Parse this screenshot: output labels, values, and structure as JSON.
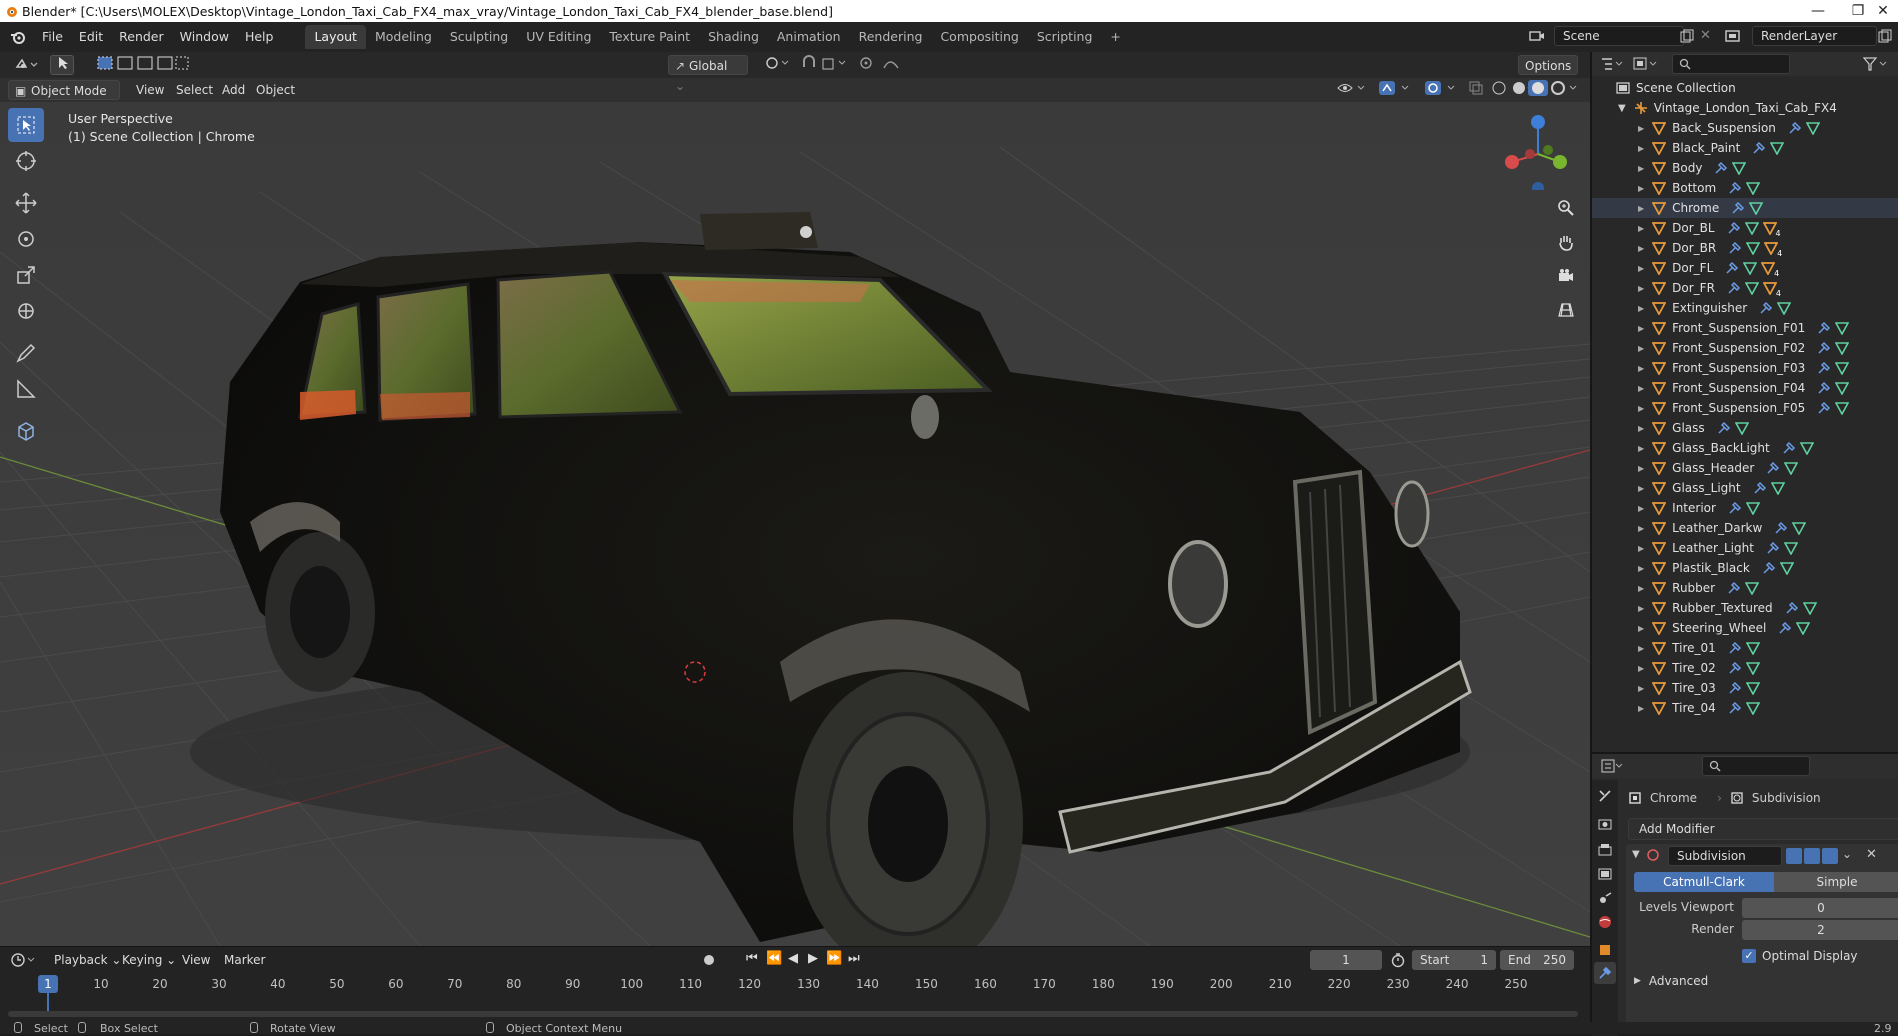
{
  "title_bar": {
    "text": "Blender* [C:\\Users\\MOLEX\\Desktop\\Vintage_London_Taxi_Cab_FX4_max_vray/Vintage_London_Taxi_Cab_FX4_blender_base.blend]",
    "minimize": "—",
    "maximize": "❐",
    "close": "✕"
  },
  "menu": [
    "File",
    "Edit",
    "Render",
    "Window",
    "Help"
  ],
  "workspaces": [
    "Layout",
    "Modeling",
    "Sculpting",
    "UV Editing",
    "Texture Paint",
    "Shading",
    "Animation",
    "Rendering",
    "Compositing",
    "Scripting",
    "+"
  ],
  "scene": {
    "name": "Scene",
    "render_layer": "RenderLayer"
  },
  "viewport_header": {
    "transform_orientation": "Global",
    "options_label": "Options ⌄",
    "mode": "Object Mode",
    "menus": [
      "View",
      "Select",
      "Add",
      "Object"
    ]
  },
  "viewport": {
    "perspective": "User Perspective",
    "collection_info": "(1) Scene Collection | Chrome",
    "accent": "#4772b3"
  },
  "outliner": {
    "root": "Scene Collection",
    "collection": "Vintage_London_Taxi_Cab_FX4",
    "items": [
      {
        "name": "Back_Suspension",
        "extra": false
      },
      {
        "name": "Black_Paint",
        "extra": false
      },
      {
        "name": "Body",
        "extra": false
      },
      {
        "name": "Bottom",
        "extra": false
      },
      {
        "name": "Chrome",
        "extra": false,
        "active": true
      },
      {
        "name": "Dor_BL",
        "extra": true,
        "extra_count": "4"
      },
      {
        "name": "Dor_BR",
        "extra": true,
        "extra_count": "4"
      },
      {
        "name": "Dor_FL",
        "extra": true,
        "extra_count": "4"
      },
      {
        "name": "Dor_FR",
        "extra": true,
        "extra_count": "4"
      },
      {
        "name": "Extinguisher",
        "extra": false
      },
      {
        "name": "Front_Suspension_F01",
        "extra": false
      },
      {
        "name": "Front_Suspension_F02",
        "extra": false
      },
      {
        "name": "Front_Suspension_F03",
        "extra": false
      },
      {
        "name": "Front_Suspension_F04",
        "extra": false
      },
      {
        "name": "Front_Suspension_F05",
        "extra": false
      },
      {
        "name": "Glass",
        "extra": false
      },
      {
        "name": "Glass_BackLight",
        "extra": false
      },
      {
        "name": "Glass_Header",
        "extra": false
      },
      {
        "name": "Glass_Light",
        "extra": false
      },
      {
        "name": "Interior",
        "extra": false
      },
      {
        "name": "Leather_Darkw",
        "extra": false
      },
      {
        "name": "Leather_Light",
        "extra": false
      },
      {
        "name": "Plastik_Black",
        "extra": false
      },
      {
        "name": "Rubber",
        "extra": false
      },
      {
        "name": "Rubber_Textured",
        "extra": false
      },
      {
        "name": "Steering_Wheel",
        "extra": false
      },
      {
        "name": "Tire_01",
        "extra": false
      },
      {
        "name": "Tire_02",
        "extra": false
      },
      {
        "name": "Tire_03",
        "extra": false
      },
      {
        "name": "Tire_04",
        "extra": false
      }
    ]
  },
  "properties": {
    "object": "Chrome",
    "modifier_tab": "Subdivision",
    "add_modifier": "Add Modifier",
    "modifier_name": "Subdivision",
    "algorithms": [
      "Catmull-Clark",
      "Simple"
    ],
    "levels_viewport_label": "Levels Viewport",
    "levels_viewport": "0",
    "render_label": "Render",
    "render_levels": "2",
    "optimal_display": "Optimal Display",
    "advanced": "Advanced"
  },
  "timeline": {
    "menus": [
      "Playback",
      "Keying",
      "View",
      "Marker"
    ],
    "current_frame": "1",
    "start_label": "Start",
    "start": "1",
    "end_label": "End",
    "end": "250",
    "ticks": [
      "1",
      "10",
      "20",
      "30",
      "40",
      "50",
      "60",
      "70",
      "80",
      "90",
      "100",
      "110",
      "120",
      "130",
      "140",
      "150",
      "160",
      "170",
      "180",
      "190",
      "200",
      "210",
      "220",
      "230",
      "240",
      "250"
    ]
  },
  "statusbar": {
    "select": "Select",
    "box_select": "Box Select",
    "rotate_view": "Rotate View",
    "context_menu": "Object Context Menu",
    "version": "2.9"
  }
}
